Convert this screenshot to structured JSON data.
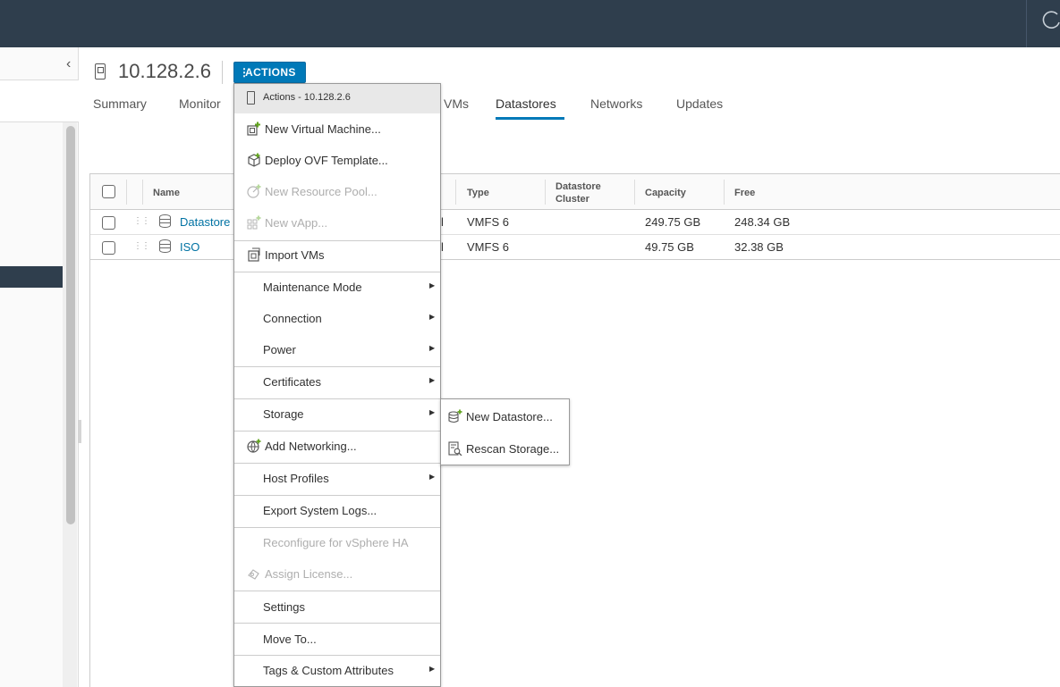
{
  "header": {
    "refresh_icon": "refresh-icon"
  },
  "host": {
    "title": "10.128.2.6",
    "actions_label": "ACTIONS"
  },
  "tabs": [
    {
      "label": "Summary"
    },
    {
      "label": "Monitor"
    },
    {
      "label": "VMs"
    },
    {
      "label": "Datastores",
      "active": true
    },
    {
      "label": "Networks"
    },
    {
      "label": "Updates"
    }
  ],
  "grid": {
    "columns": [
      "Name",
      "Type",
      "Datastore Cluster",
      "Capacity",
      "Free"
    ],
    "rows": [
      {
        "name": "Datastore",
        "type": "VMFS 6",
        "cluster": "",
        "capacity": "249.75 GB",
        "free": "248.34 GB",
        "status_fragment": "l"
      },
      {
        "name": "ISO",
        "type": "VMFS 6",
        "cluster": "",
        "capacity": "49.75 GB",
        "free": "32.38 GB",
        "status_fragment": "l"
      }
    ]
  },
  "menu": {
    "header": "Actions - 10.128.2.6",
    "items": [
      {
        "label": "New Virtual Machine...",
        "icon": "new-vm-icon",
        "disabled": false
      },
      {
        "label": "Deploy OVF Template...",
        "icon": "deploy-ovf-icon",
        "disabled": false
      },
      {
        "label": "New Resource Pool...",
        "icon": "resource-pool-icon",
        "disabled": true
      },
      {
        "label": "New vApp...",
        "icon": "vapp-icon",
        "disabled": true
      },
      {
        "label": "Import VMs",
        "icon": "import-vms-icon",
        "disabled": false
      },
      {
        "label": "Maintenance Mode",
        "submenu": true
      },
      {
        "label": "Connection",
        "submenu": true
      },
      {
        "label": "Power",
        "submenu": true
      },
      {
        "label": "Certificates",
        "submenu": true
      },
      {
        "label": "Storage",
        "submenu": true,
        "open": true
      },
      {
        "label": "Add Networking...",
        "icon": "add-networking-icon",
        "disabled": false
      },
      {
        "label": "Host Profiles",
        "submenu": true
      },
      {
        "label": "Export System Logs...",
        "disabled": false
      },
      {
        "label": "Reconfigure for vSphere HA",
        "disabled": true
      },
      {
        "label": "Assign License...",
        "icon": "license-icon",
        "disabled": true
      },
      {
        "label": "Settings",
        "disabled": false
      },
      {
        "label": "Move To...",
        "disabled": false
      },
      {
        "label": "Tags & Custom Attributes",
        "submenu": true
      }
    ]
  },
  "storage_submenu": [
    {
      "label": "New Datastore...",
      "icon": "new-datastore-icon"
    },
    {
      "label": "Rescan Storage...",
      "icon": "rescan-storage-icon"
    }
  ],
  "colors": {
    "topbar": "#2f3e4d",
    "primary": "#0079b8",
    "link": "#0072a3",
    "add_badge": "#62a420"
  }
}
